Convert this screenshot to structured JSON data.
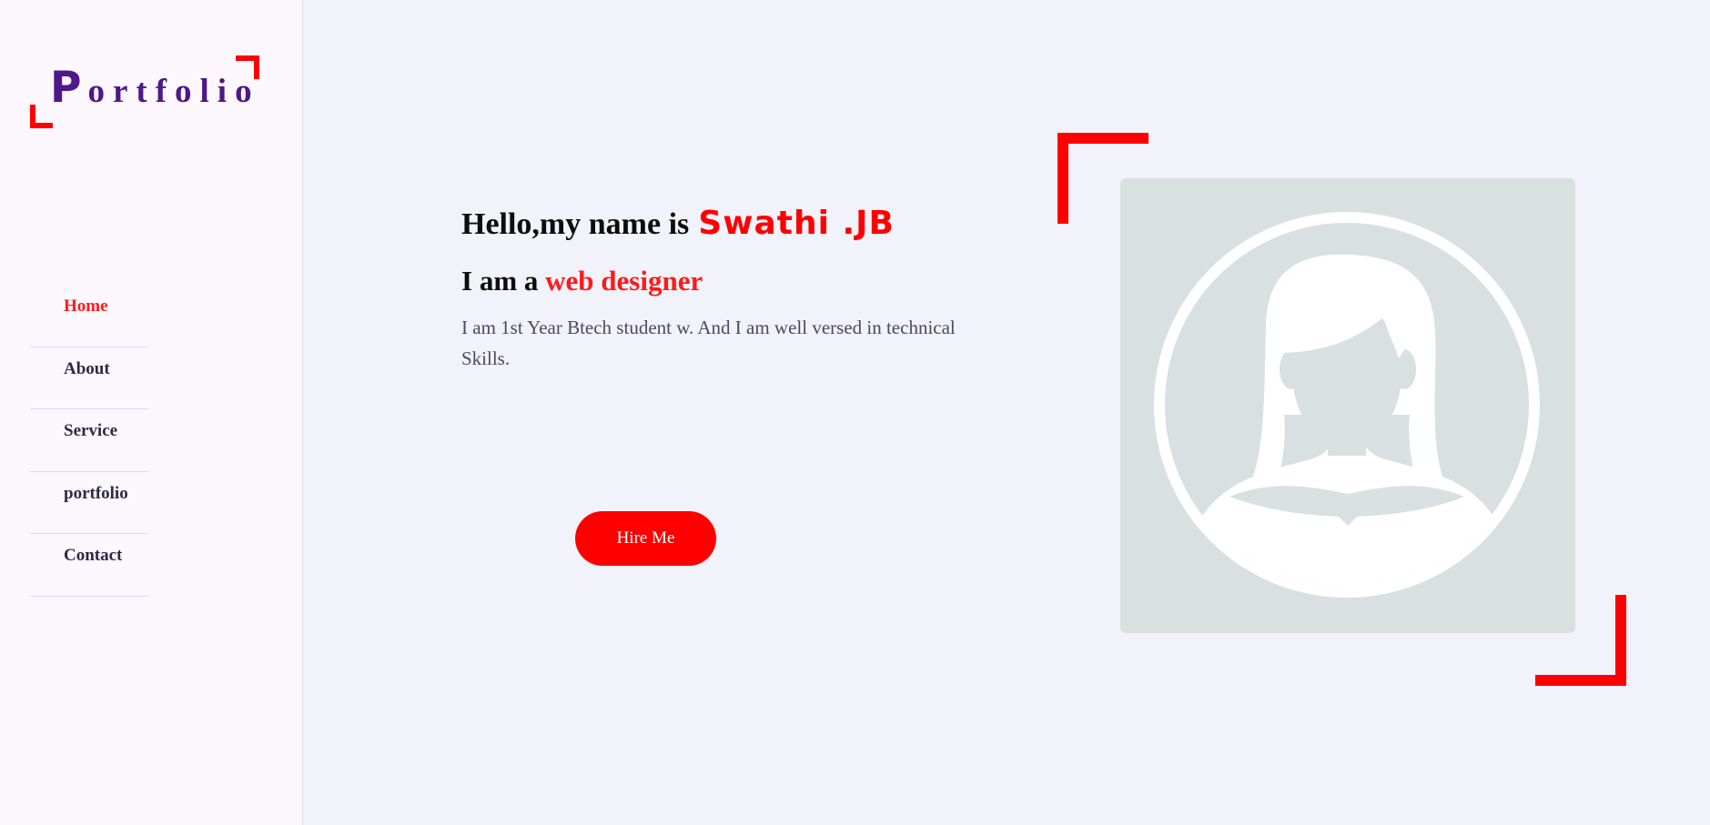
{
  "sidebar": {
    "logo": {
      "first_letter": "P",
      "rest": "ortfolio"
    },
    "nav": [
      {
        "label": "Home",
        "active": true
      },
      {
        "label": "About",
        "active": false
      },
      {
        "label": "Service",
        "active": false
      },
      {
        "label": "portfolio",
        "active": false
      },
      {
        "label": "Contact",
        "active": false
      }
    ]
  },
  "hero": {
    "greeting": "Hello,my name is",
    "name": "Swathi .JB",
    "role_prefix": "I am a",
    "role": "web designer",
    "bio": "I am 1st Year Btech student w. And I am well versed in technical Skills.",
    "cta_label": "Hire Me"
  },
  "avatar": {
    "icon": "female-user-placeholder-icon"
  },
  "colors": {
    "accent": "#ff0000",
    "logo": "#4f1787",
    "background": "#f2f2fb",
    "sidebar_background": "#fcf7fd",
    "avatar_background": "#d8e0e1"
  }
}
